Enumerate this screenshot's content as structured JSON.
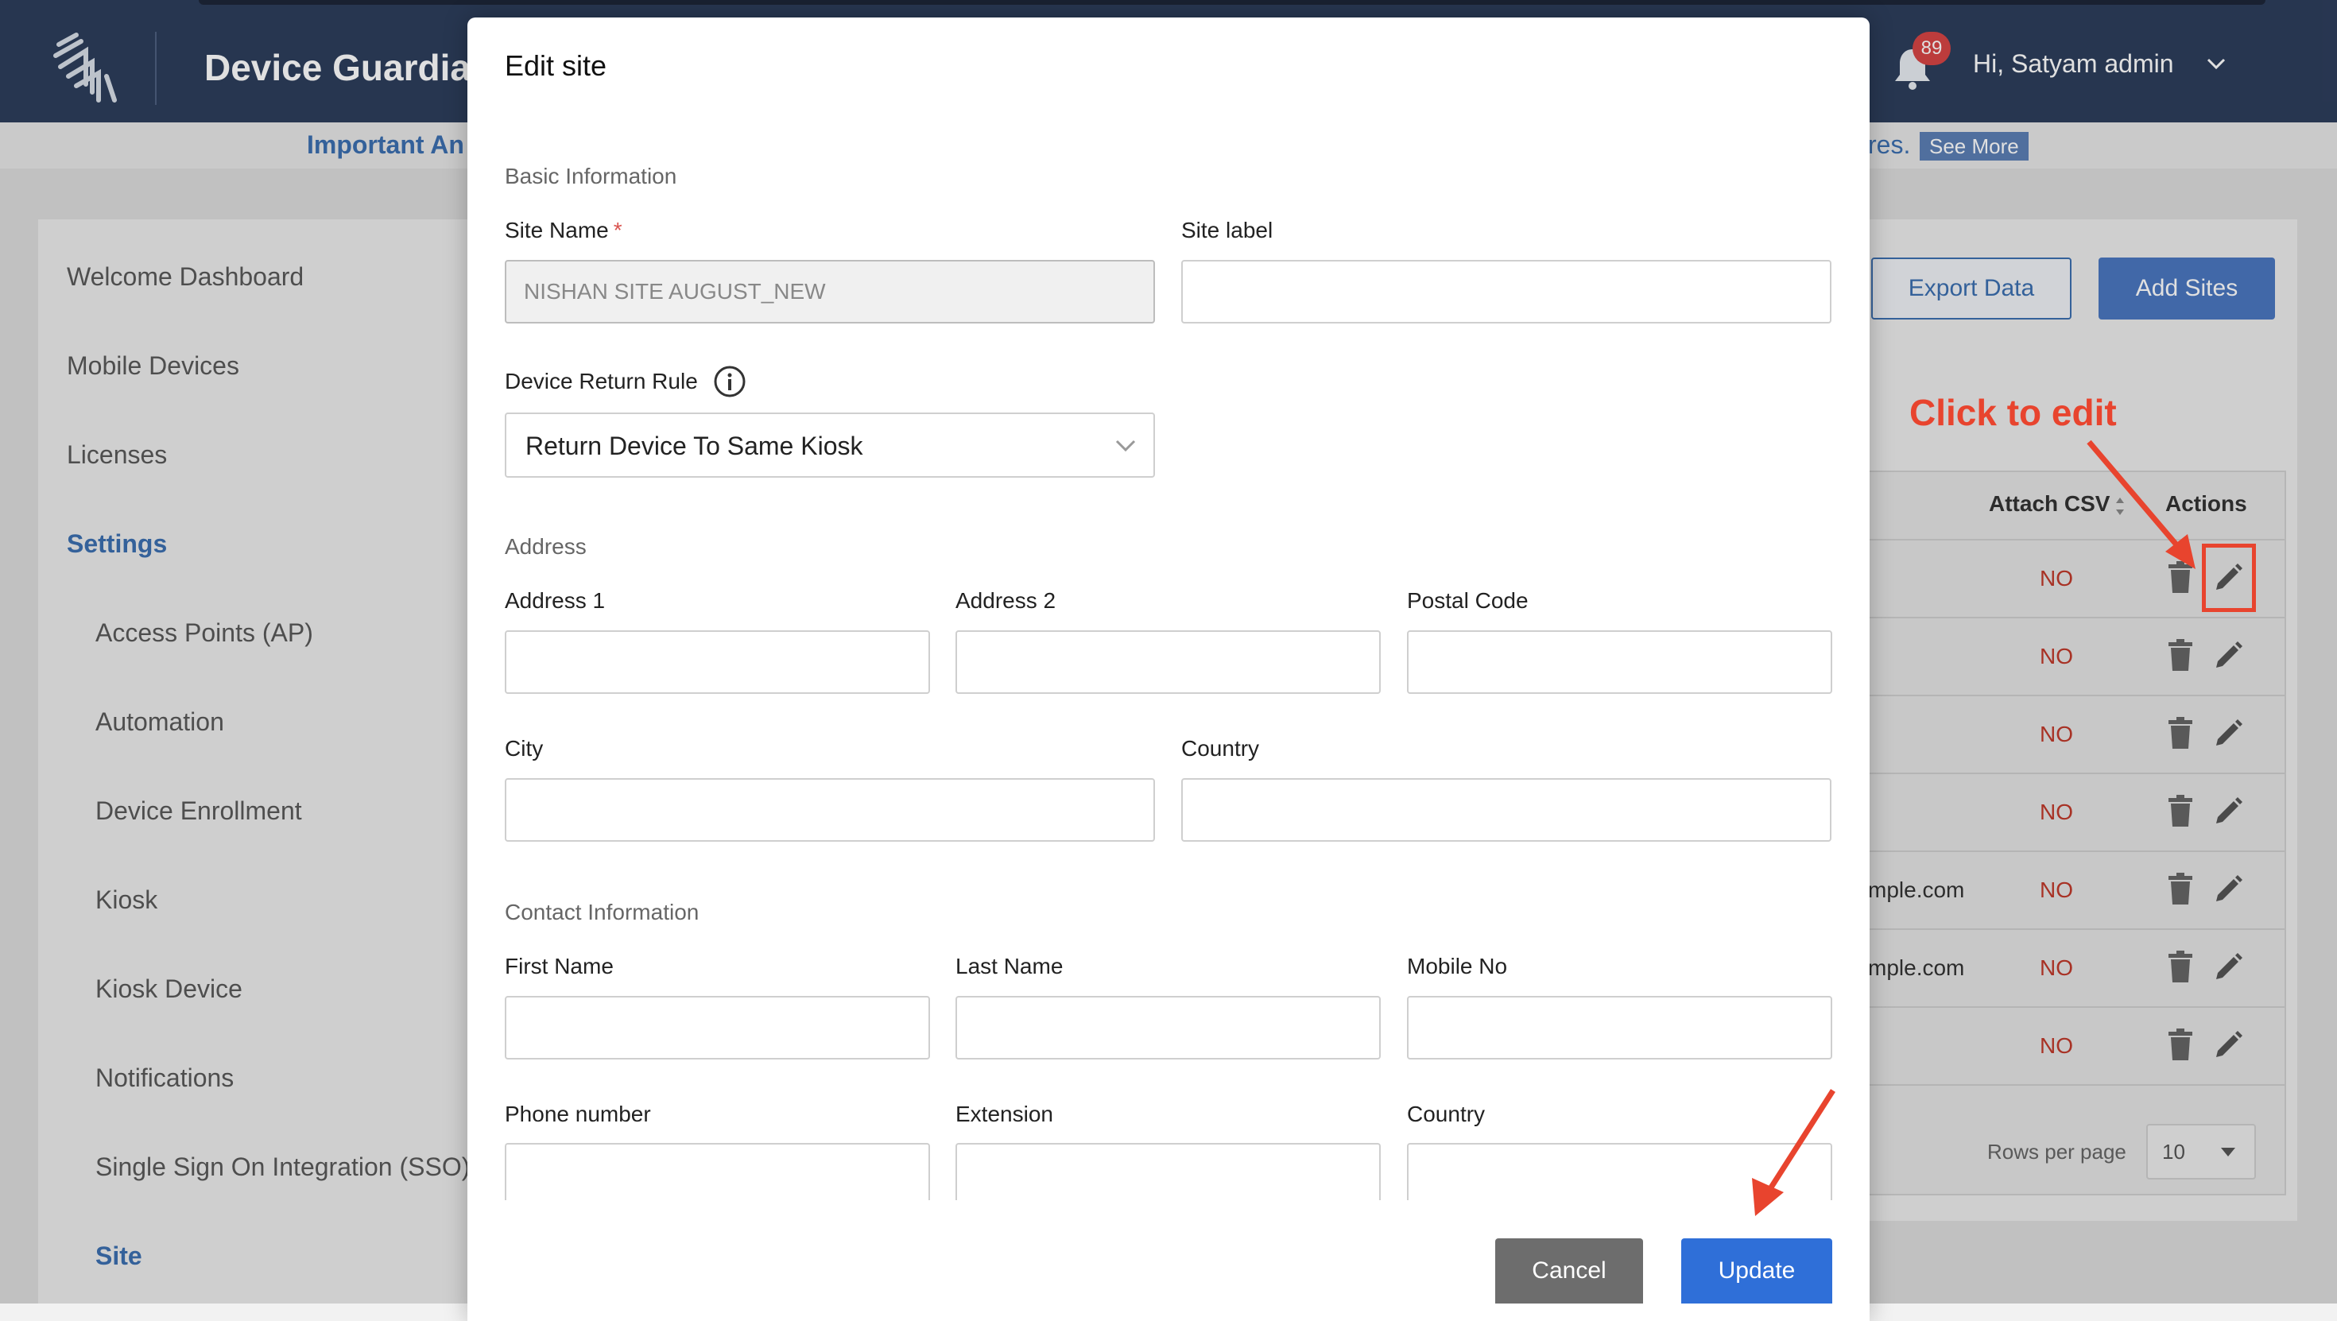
{
  "app": {
    "title": "Device Guardia",
    "notification_count": "89",
    "user_greeting": "Hi, Satyam admin"
  },
  "announcement": {
    "left_text": "Important An",
    "right_text": "res.",
    "see_more_label": "See More"
  },
  "sidebar": {
    "items": [
      {
        "label": "Welcome Dashboard"
      },
      {
        "label": "Mobile Devices"
      },
      {
        "label": "Licenses"
      },
      {
        "label": "Settings"
      },
      {
        "label": "Access Points (AP)"
      },
      {
        "label": "Automation"
      },
      {
        "label": "Device Enrollment"
      },
      {
        "label": "Kiosk"
      },
      {
        "label": "Kiosk Device"
      },
      {
        "label": "Notifications"
      },
      {
        "label": "Single Sign On Integration (SSO)"
      },
      {
        "label": "Site"
      }
    ]
  },
  "main": {
    "export_label": "Export Data",
    "add_label": "Add Sites",
    "table": {
      "headers": {
        "attach_csv": "Attach CSV",
        "actions": "Actions"
      },
      "rows": [
        {
          "email": "",
          "attach_csv": "NO"
        },
        {
          "email": "",
          "attach_csv": "NO"
        },
        {
          "email": "",
          "attach_csv": "NO"
        },
        {
          "email": "",
          "attach_csv": "NO"
        },
        {
          "email": "mple.com",
          "attach_csv": "NO"
        },
        {
          "email": "mple.com",
          "attach_csv": "NO"
        },
        {
          "email": "",
          "attach_csv": "NO"
        }
      ]
    },
    "rows_per_page_label": "Rows per page",
    "rows_per_page_value": "10"
  },
  "annotation": {
    "text": "Click to edit",
    "color": "#e8442e"
  },
  "modal": {
    "title": "Edit site",
    "basic_section": "Basic Information",
    "site_name_label": "Site Name",
    "site_name_required": "*",
    "site_name_value": "NISHAN SITE AUGUST_NEW",
    "site_label_label": "Site label",
    "site_label_value": "",
    "return_rule_label": "Device Return Rule",
    "return_rule_value": "Return Device To Same Kiosk",
    "address_section": "Address",
    "address1_label": "Address 1",
    "address2_label": "Address 2",
    "postal_label": "Postal Code",
    "city_label": "City",
    "country_label": "Country",
    "contact_section": "Contact Information",
    "first_name_label": "First Name",
    "last_name_label": "Last Name",
    "mobile_label": "Mobile No",
    "phone_label": "Phone number",
    "extension_label": "Extension",
    "contact_country_label": "Country",
    "cancel_label": "Cancel",
    "update_label": "Update"
  },
  "colors": {
    "header_bg": "#2d3e5c",
    "accent": "#3c6fb0",
    "primary_button": "#2f6fd8",
    "cancel_button": "#6d6d6d",
    "status_no": "#c0392b"
  }
}
